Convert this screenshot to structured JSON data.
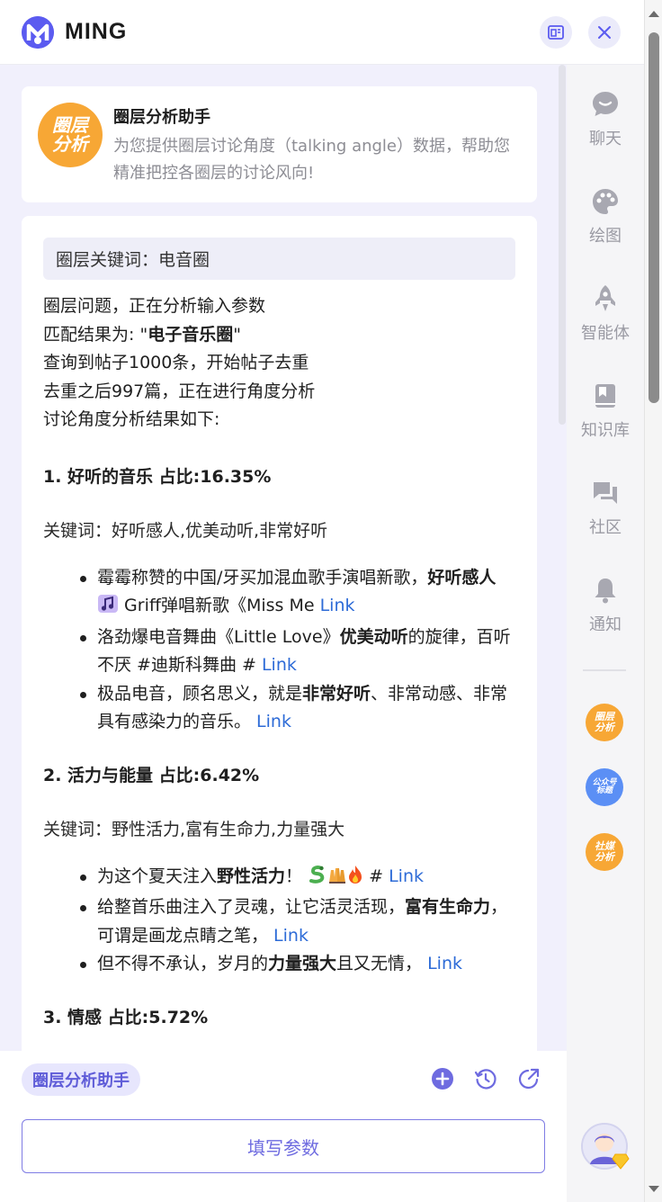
{
  "app": {
    "logo_letter": "M",
    "title": "MING"
  },
  "assistant": {
    "badge_line1": "圈层",
    "badge_line2": "分析",
    "name": "圈层分析助手",
    "description": "为您提供圈层讨论角度（talking angle）数据，帮助您精准把控各圈层的讨论风向!"
  },
  "message": {
    "keyword_label": "圈层关键词：电音圈",
    "log_line1": "圈层问题，正在分析输入参数",
    "log_line2_prefix": "匹配结果为: \"",
    "log_line2_bold": "电子音乐圈",
    "log_line2_suffix": "\"",
    "log_line3": "查询到帖子1000条，开始帖子去重",
    "log_line4": "去重之后997篇，正在进行角度分析",
    "log_line5": "讨论角度分析结果如下:",
    "sections": [
      {
        "title": "1. 好听的音乐 占比:16.35%",
        "keywords": "关键词：好听感人,优美动听,非常好听",
        "b1_pre": "霉霉称赞的中国/牙买加混血歌手演唱新歌，",
        "b1_bold": "好听感人",
        "b1_post": "Griff弹唱新歌《Miss Me ",
        "b2_pre": "洛劲爆电音舞曲《Little Love》",
        "b2_bold": "优美动听",
        "b2_post": "的旋律，百听不厌 #迪斯科舞曲 # ",
        "b3_pre": "极品电音，顾名思义，就是",
        "b3_bold": "非常好听",
        "b3_post": "、非常动感、非常具有感染力的音乐。 "
      },
      {
        "title": "2. 活力与能量 占比:6.42%",
        "keywords": "关键词：野性活力,富有生命力,力量强大",
        "b1_pre": "为这个夏天注入",
        "b1_bold": "野性活力",
        "b1_post": "！",
        "b1_post2": " # ",
        "b2_pre": "给整首乐曲注入了灵魂，让它活灵活现，",
        "b2_bold": "富有生命力",
        "b2_post": "，可谓是画龙点睛之笔， ",
        "b3_pre": "但不得不承认，岁月的",
        "b3_bold": "力量强大",
        "b3_post": "且又无情， "
      },
      {
        "title": "3. 情感 占比:5.72%"
      }
    ],
    "link_text": "Link"
  },
  "rail": {
    "chat": "聊天",
    "draw": "绘图",
    "agent": "智能体",
    "kb": "知识库",
    "community": "社区",
    "notify": "通知",
    "b1_l1": "圈层",
    "b1_l2": "分析",
    "b2_l1": "公众号",
    "b2_l2": "标题",
    "b3_l1": "社媒",
    "b3_l2": "分析"
  },
  "bottom": {
    "chip": "圈层分析助手",
    "fill_button": "填写参数"
  },
  "colors": {
    "accent": "#5b5bf0",
    "badge_orange": "#f7a735",
    "badge_blue": "#5b8ff5",
    "link": "#2d6bd7"
  }
}
